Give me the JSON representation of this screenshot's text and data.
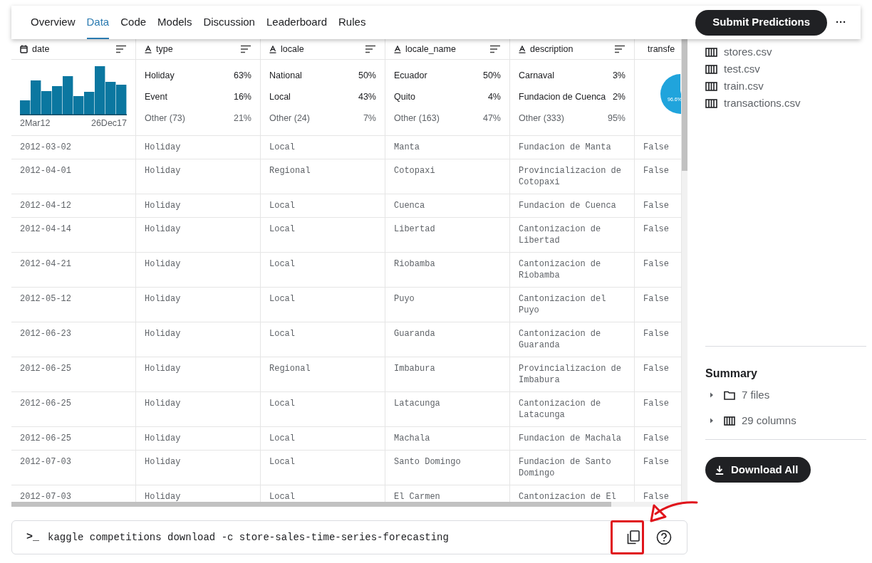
{
  "tabs": [
    {
      "label": "Overview",
      "selected": false
    },
    {
      "label": "Data",
      "selected": true
    },
    {
      "label": "Code",
      "selected": false
    },
    {
      "label": "Models",
      "selected": false
    },
    {
      "label": "Discussion",
      "selected": false
    },
    {
      "label": "Leaderboard",
      "selected": false
    },
    {
      "label": "Rules",
      "selected": false
    }
  ],
  "submit_button": "Submit Predictions",
  "more_button": "···",
  "table": {
    "columns": [
      {
        "name": "date",
        "kind": "date",
        "summary": {
          "kind": "histogram",
          "start": "2Mar12",
          "end": "26Dec17"
        }
      },
      {
        "name": "type",
        "kind": "string",
        "summary": {
          "kind": "top",
          "items": [
            {
              "label": "Holiday",
              "share": "63%",
              "kind": "value"
            },
            {
              "label": "Event",
              "share": "16%",
              "kind": "value"
            },
            {
              "label": "Other (73)",
              "share": "21%",
              "kind": "other"
            }
          ]
        }
      },
      {
        "name": "locale",
        "kind": "string",
        "summary": {
          "kind": "top",
          "items": [
            {
              "label": "National",
              "share": "50%",
              "kind": "value"
            },
            {
              "label": "Local",
              "share": "43%",
              "kind": "value"
            },
            {
              "label": "Other (24)",
              "share": "7%",
              "kind": "other"
            }
          ]
        }
      },
      {
        "name": "locale_name",
        "kind": "string",
        "summary": {
          "kind": "top",
          "items": [
            {
              "label": "Ecuador",
              "share": "50%",
              "kind": "value"
            },
            {
              "label": "Quito",
              "share": "4%",
              "kind": "value"
            },
            {
              "label": "Other (163)",
              "share": "47%",
              "kind": "other"
            }
          ]
        }
      },
      {
        "name": "description",
        "kind": "string",
        "summary": {
          "kind": "top",
          "items": [
            {
              "label": "Carnaval",
              "share": "3%",
              "kind": "value"
            },
            {
              "label": "Fundacion de Cuenca",
              "share": "2%",
              "kind": "value"
            },
            {
              "label": "Other (333)",
              "share": "95%",
              "kind": "other"
            }
          ]
        }
      },
      {
        "name": "transfe",
        "kind": "boolean",
        "summary": {
          "kind": "pie",
          "label": "96.6%"
        }
      }
    ],
    "rows": [
      [
        "2012-03-02",
        "Holiday",
        "Local",
        "Manta",
        "Fundacion de Manta",
        "False"
      ],
      [
        "2012-04-01",
        "Holiday",
        "Regional",
        "Cotopaxi",
        "Provincializacion de Cotopaxi",
        "False"
      ],
      [
        "2012-04-12",
        "Holiday",
        "Local",
        "Cuenca",
        "Fundacion de Cuenca",
        "False"
      ],
      [
        "2012-04-14",
        "Holiday",
        "Local",
        "Libertad",
        "Cantonizacion de Libertad",
        "False"
      ],
      [
        "2012-04-21",
        "Holiday",
        "Local",
        "Riobamba",
        "Cantonizacion de Riobamba",
        "False"
      ],
      [
        "2012-05-12",
        "Holiday",
        "Local",
        "Puyo",
        "Cantonizacion del Puyo",
        "False"
      ],
      [
        "2012-06-23",
        "Holiday",
        "Local",
        "Guaranda",
        "Cantonizacion de Guaranda",
        "False"
      ],
      [
        "2012-06-25",
        "Holiday",
        "Regional",
        "Imbabura",
        "Provincializacion de Imbabura",
        "False"
      ],
      [
        "2012-06-25",
        "Holiday",
        "Local",
        "Latacunga",
        "Cantonizacion de Latacunga",
        "False"
      ],
      [
        "2012-06-25",
        "Holiday",
        "Local",
        "Machala",
        "Fundacion de Machala",
        "False"
      ],
      [
        "2012-07-03",
        "Holiday",
        "Local",
        "Santo Domingo",
        "Fundacion de Santo Domingo",
        "False"
      ],
      [
        "2012-07-03",
        "Holiday",
        "Local",
        "El Carmen",
        "Cantonizacion de El",
        "False"
      ]
    ]
  },
  "files": [
    "stores.csv",
    "test.csv",
    "train.csv",
    "transactions.csv"
  ],
  "summary": {
    "title": "Summary",
    "items": [
      {
        "kind": "folder",
        "label": "7 files",
        "expanded": false
      },
      {
        "kind": "columns",
        "label": "29 columns",
        "expanded": false
      }
    ]
  },
  "download_button": "Download All",
  "command": {
    "prompt": ">_",
    "text": "kaggle competitions download -c store-sales-time-series-forecasting"
  }
}
